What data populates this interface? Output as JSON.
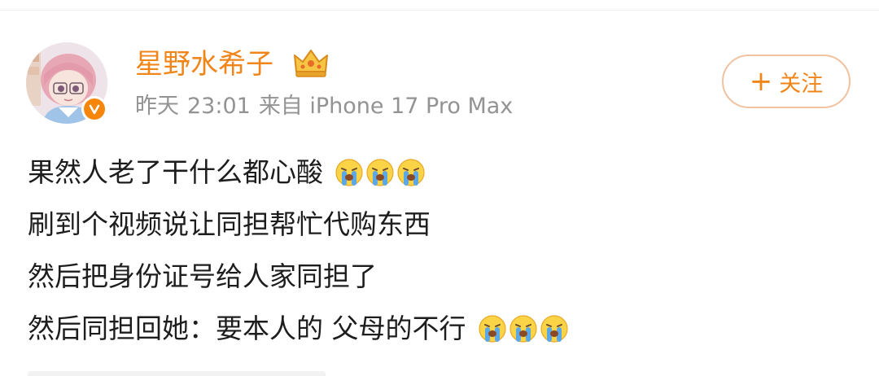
{
  "post": {
    "username": "星野水希子",
    "time_day": "昨天",
    "time_clock": "23:01",
    "source": "来自 iPhone 17 Pro Max",
    "follow_label": "关注",
    "lines": [
      "果然人老了干什么都心酸",
      "刷到个视频说让同担帮忙代购东西",
      "然后把身份证号给人家同担了",
      "然后同担回她：要本人的 父母的不行"
    ],
    "emoji": "crying-face"
  },
  "colors": {
    "accent": "#f0851a",
    "meta_text": "#939393",
    "body_text": "#1d1d1d",
    "follow_border": "#f0c2a0",
    "verified": "#f5860a"
  },
  "icons": [
    "avatar",
    "verified-badge-icon",
    "crown-icon",
    "plus-icon",
    "crying-face-icon"
  ]
}
